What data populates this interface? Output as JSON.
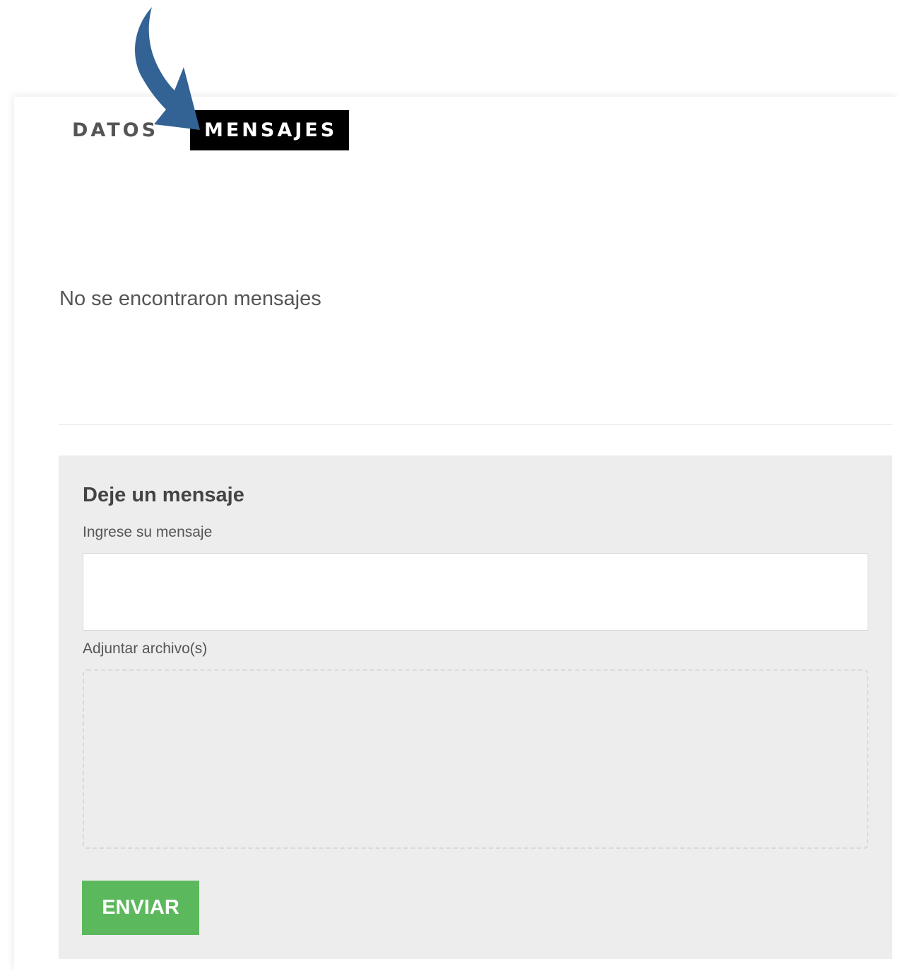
{
  "tabs": {
    "datos": "DATOS",
    "mensajes": "MENSAJES"
  },
  "messages": {
    "empty_text": "No se encontraron mensajes"
  },
  "form": {
    "title": "Deje un mensaje",
    "message_label": "Ingrese su mensaje",
    "message_value": "",
    "attach_label": "Adjuntar archivo(s)",
    "submit_label": "ENVIAR"
  },
  "annotation": {
    "arrow_color": "#336294"
  },
  "colors": {
    "active_tab_bg": "#000000",
    "submit_bg": "#5cb85c",
    "panel_bg": "#ededed"
  }
}
